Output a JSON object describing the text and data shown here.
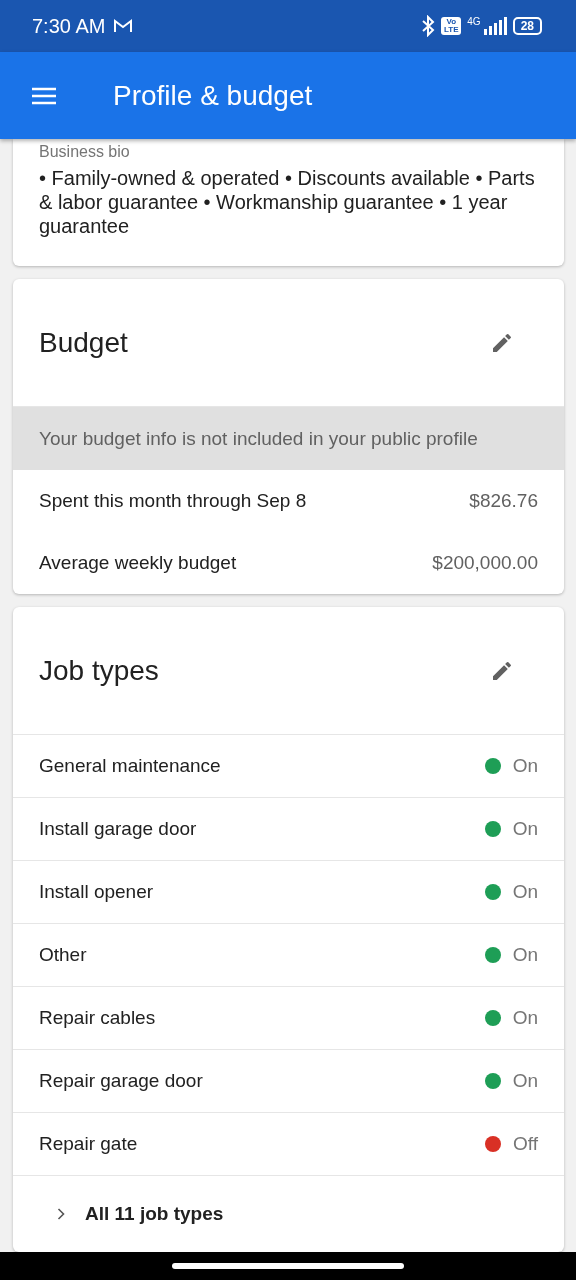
{
  "status_bar": {
    "time": "7:30 AM",
    "volte": "Vo LTE",
    "network": "4G",
    "battery": "28"
  },
  "app_bar": {
    "title": "Profile & budget"
  },
  "bio": {
    "label": "Business bio",
    "text": " • Family-owned & operated • Discounts available • Parts & labor guarantee • Workmanship guarantee • 1 year guarantee"
  },
  "budget": {
    "title": "Budget",
    "notice": "Your budget info is not included in your public profile",
    "rows": [
      {
        "label": "Spent this month through Sep 8",
        "value": "$826.76"
      },
      {
        "label": "Average weekly budget",
        "value": "$200,000.00"
      }
    ]
  },
  "job_types": {
    "title": "Job types",
    "items": [
      {
        "name": "General maintenance",
        "on": true,
        "status": "On"
      },
      {
        "name": "Install garage door",
        "on": true,
        "status": "On"
      },
      {
        "name": "Install opener",
        "on": true,
        "status": "On"
      },
      {
        "name": "Other",
        "on": true,
        "status": "On"
      },
      {
        "name": "Repair cables",
        "on": true,
        "status": "On"
      },
      {
        "name": "Repair garage door",
        "on": true,
        "status": "On"
      },
      {
        "name": "Repair gate",
        "on": false,
        "status": "Off"
      }
    ],
    "all_link": "All 11 job types"
  }
}
